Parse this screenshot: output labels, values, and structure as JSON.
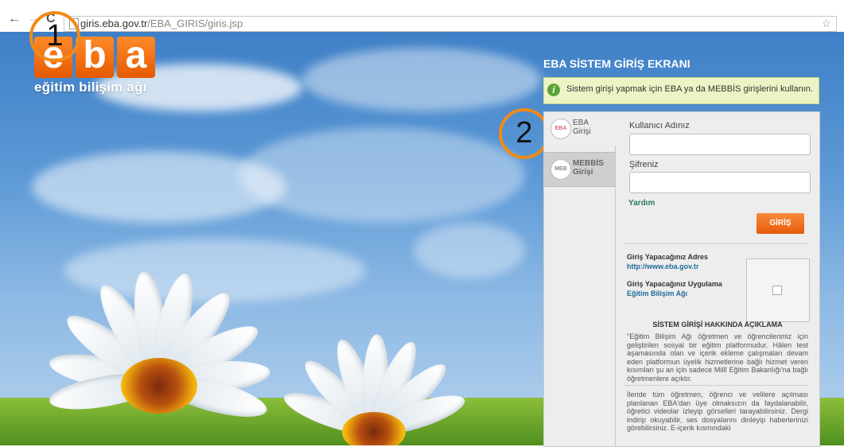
{
  "browser": {
    "back_icon": "←",
    "forward_icon": "→",
    "reload_icon": "C",
    "url_host": "giris.eba.gov.tr",
    "url_path": "/EBA_GIRIS/giris.jsp",
    "bookmark_icon": "☆"
  },
  "logo": {
    "letters": [
      "e",
      "b",
      "a"
    ],
    "subtitle": "eğitim bilişim ağı",
    "color": "#f26b0f"
  },
  "annotations": [
    "1",
    "2"
  ],
  "login": {
    "title": "EBA SİSTEM GİRİŞ EKRANI",
    "info_icon": "i",
    "info_text": "Sistem girişi yapmak için EBA ya da MEBBİS girişlerini kullanın.",
    "tabs": [
      {
        "icon_text": "EBA",
        "line1": "EBA",
        "line2": "Girişi"
      },
      {
        "icon_text": "MEB",
        "line1": "MEBBİS",
        "line2": "Girişi"
      }
    ],
    "username_label": "Kullanıcı Adınız",
    "username_value": "",
    "password_label": "Şifreniz",
    "password_value": "",
    "help_link": "Yardım",
    "login_button": "GİRİŞ",
    "accent_color": "#f2741f"
  },
  "details": {
    "address_label": "Giriş Yapacağınız Adres",
    "address_value": "http://www.eba.gov.tr",
    "app_label": "Giriş Yapacağınız Uygulama",
    "app_value": "Eğitim Bilişim Ağı",
    "desc_title": "SİSTEM GİRİŞİ HAKKINDA AÇIKLAMA",
    "desc_p1": "\"Eğitim Bilişim Ağı öğretmen ve öğrencilerimiz için geliştirilen sosyal bir eğitim platformudur. Hâlen test aşamasında olan ve içerik ekleme çalışmaları devam eden platformun üyelik hizmetlerine bağlı hizmet veren kısımları şu an için sadece Millî Eğitim Bakanlığı'na bağlı öğretmenlere açıktır.",
    "desc_p2": "İleride tüm öğretmen, öğrenci ve velilere açılması planlanan EBA'dan üye olmaksızın da faydalanabilir, öğretici videolar izleyip görselleri tarayabilirsiniz. Dergi indirip okuyabilir, ses dosyalarını dinleyip haberlerinizi görebilirsiniz. E-içerik kısmındaki"
  }
}
